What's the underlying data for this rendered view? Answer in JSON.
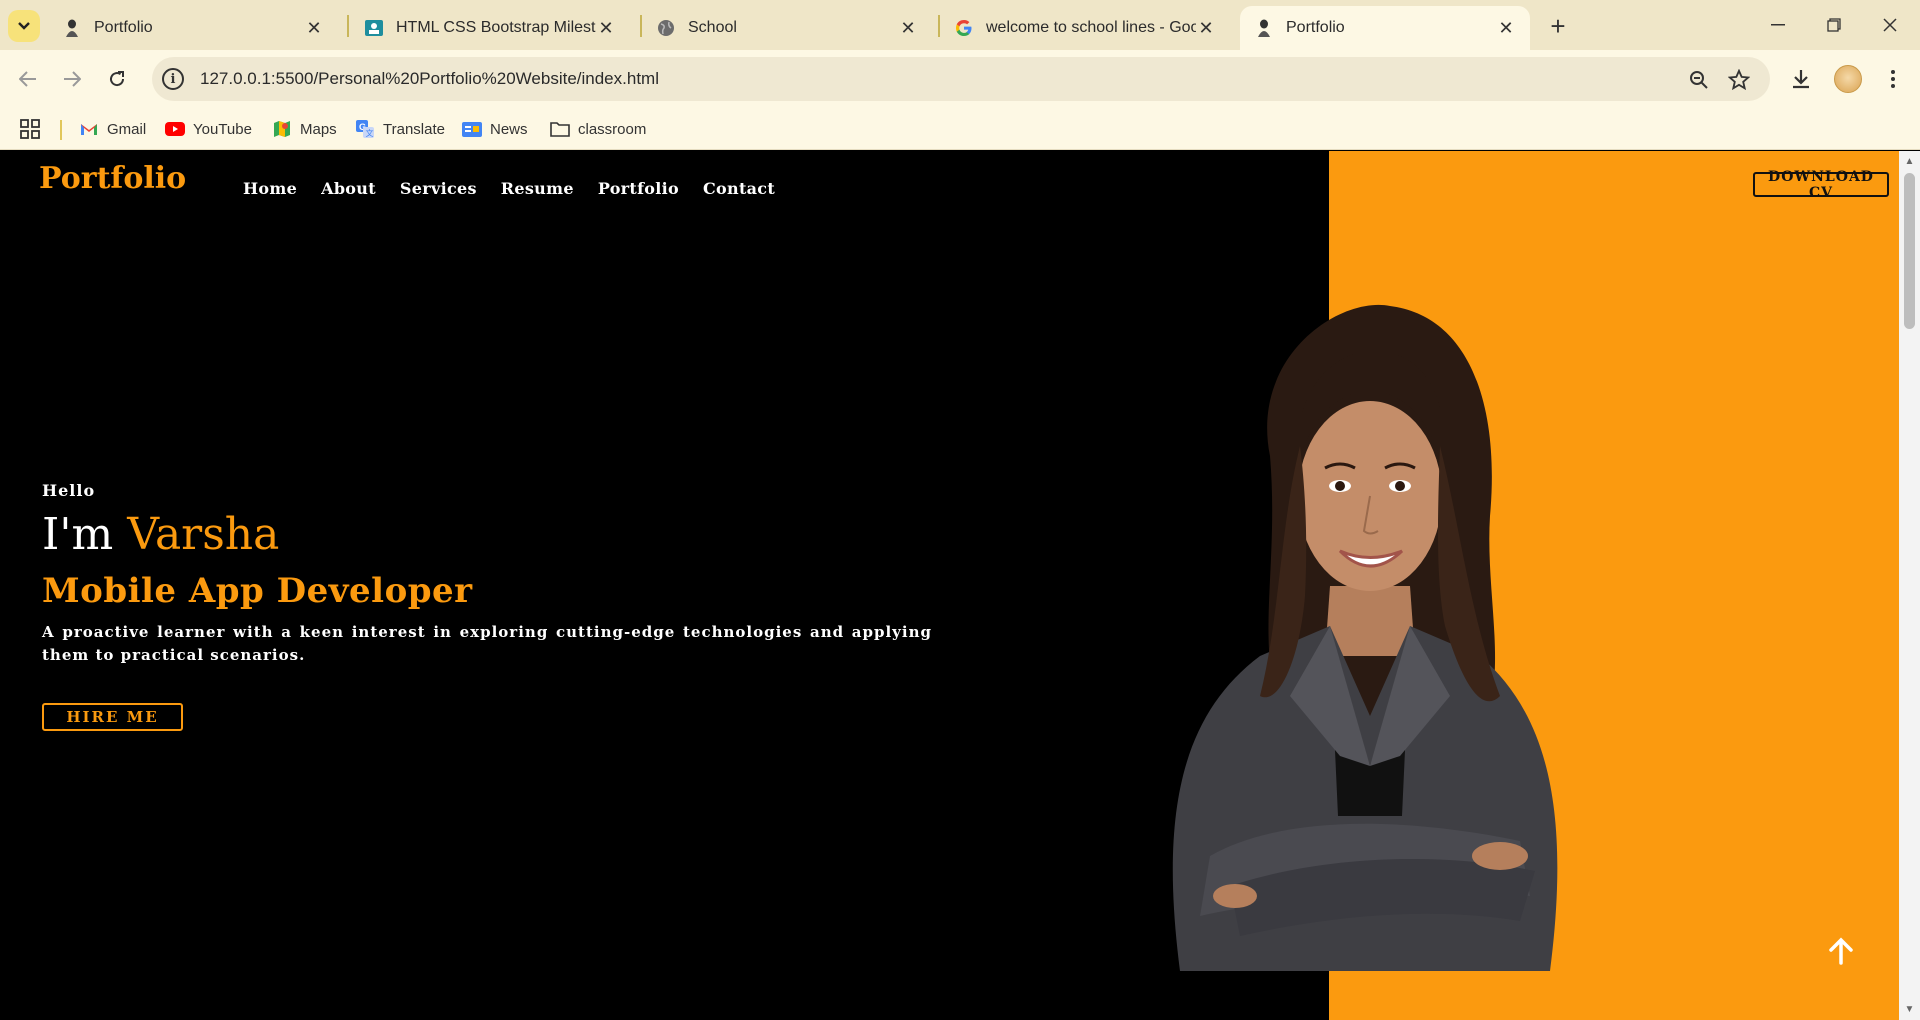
{
  "browser": {
    "tabs": [
      {
        "title": "Portfolio",
        "icon": "portfolio-favicon-icon"
      },
      {
        "title": "HTML CSS Bootstrap Milestone",
        "icon": "classroom-favicon-icon"
      },
      {
        "title": "School",
        "icon": "globe-icon"
      },
      {
        "title": "welcome to school lines - Goog",
        "icon": "google-icon"
      },
      {
        "title": "Portfolio",
        "icon": "portfolio-favicon-icon",
        "active": true
      }
    ],
    "url": "127.0.0.1:5500/Personal%20Portfolio%20Website/index.html",
    "bookmarks": [
      {
        "label": "Gmail",
        "icon": "gmail-icon"
      },
      {
        "label": "YouTube",
        "icon": "youtube-icon"
      },
      {
        "label": "Maps",
        "icon": "maps-icon"
      },
      {
        "label": "Translate",
        "icon": "translate-icon"
      },
      {
        "label": "News",
        "icon": "news-icon"
      },
      {
        "label": "classroom",
        "icon": "folder-icon"
      }
    ]
  },
  "page": {
    "logo": "Portfolio",
    "nav": [
      "Home",
      "About",
      "Services",
      "Resume",
      "Portfolio",
      "Contact"
    ],
    "download_cv": "DOWNLOAD CV",
    "hero": {
      "greeting": "Hello",
      "im": "I'm",
      "name": "Varsha",
      "role": "Mobile App Developer",
      "description": "A proactive learner with a keen interest in exploring cutting-edge technologies and applying them to practical scenarios.",
      "hire_button": "HIRE ME"
    },
    "colors": {
      "accent": "#fb9a0f",
      "background": "#000000",
      "text": "#ffffff"
    }
  }
}
